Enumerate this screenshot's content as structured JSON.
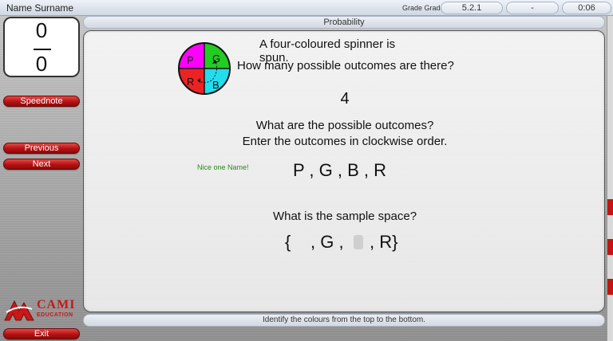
{
  "header": {
    "user_name": "Name Surname",
    "grade_label": "Grade Grade",
    "code": "5.2.1",
    "dash": "-",
    "time": "0:06"
  },
  "title": "Probability",
  "score": {
    "correct": "0",
    "total": "0"
  },
  "buttons": {
    "speednote": "Speednote",
    "previous": "Previous",
    "next": "Next",
    "exit": "Exit"
  },
  "question": {
    "line1": "A four-coloured spinner is spun.",
    "line2": "How many possible outcomes are there?",
    "answer_count": "4",
    "line3": "What are the possible outcomes?",
    "line4": "Enter the outcomes in clockwise order.",
    "praise": "Nice one Name!",
    "outcomes": "P , G , B , R",
    "line5": "What is the sample space?",
    "sample_open": "{",
    "sample_g": ", G ,",
    "sample_r": ", R}"
  },
  "spinner": {
    "labels": [
      "P",
      "G",
      "R",
      "B"
    ],
    "colors": [
      "#ff00ff",
      "#22cc22",
      "#ee2222",
      "#22ddee"
    ]
  },
  "hint": "Identify the colours from the top to the bottom.",
  "logo": {
    "text": "CAMI",
    "sub": "EDUCATION"
  }
}
